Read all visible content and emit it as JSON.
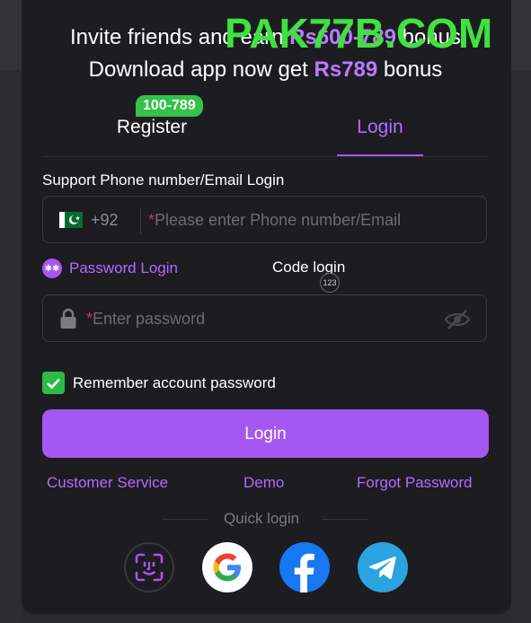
{
  "watermark": "PAK77B.COM",
  "promo": {
    "line1_prefix": "Invite friends and earn ",
    "line1_amount": "Rs600-789",
    "line1_suffix": " bonus",
    "line2_prefix": "Download app now get ",
    "line2_amount": "Rs789",
    "line2_suffix": " bonus"
  },
  "tabs": {
    "register": "Register",
    "register_badge": "100-789",
    "login": "Login",
    "active": "login"
  },
  "form": {
    "support_label": "Support Phone number/Email Login",
    "country_code": "+92",
    "phone_placeholder": "Please enter Phone number/Email",
    "password_placeholder": "Enter password",
    "required_mark": "*"
  },
  "login_options": {
    "password_login": "Password Login",
    "code_login": "Code login",
    "code_icon_text": "123",
    "selected": "password_login"
  },
  "remember": {
    "label": "Remember account password",
    "checked": true
  },
  "login_button": "Login",
  "links": {
    "customer_service": "Customer Service",
    "demo": "Demo",
    "forgot_password": "Forgot Password"
  },
  "quick_login": {
    "label": "Quick login",
    "providers": [
      "face-id-icon",
      "google-icon",
      "facebook-icon",
      "telegram-icon"
    ]
  },
  "colors": {
    "accent": "#a557f1",
    "accent_text": "#b26bff",
    "badge_green": "#33c24a",
    "watermark_green": "#3fe23f",
    "panel_bg": "#1d1c21"
  }
}
